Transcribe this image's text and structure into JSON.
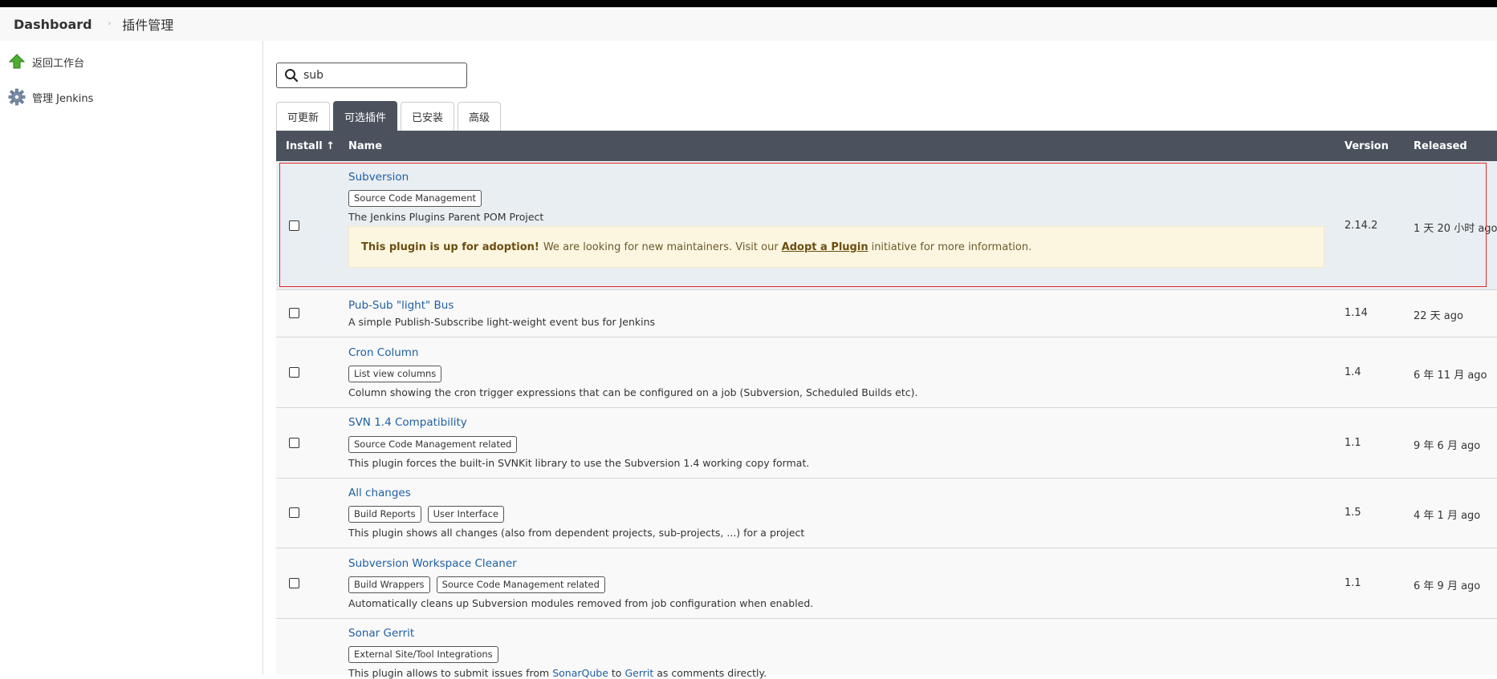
{
  "breadcrumb": {
    "dashboard": "Dashboard",
    "page": "插件管理",
    "separator": "›"
  },
  "sidebar": {
    "items": [
      {
        "label": "返回工作台",
        "icon": "arrow-up-icon"
      },
      {
        "label": "管理 Jenkins",
        "icon": "gear-icon"
      }
    ]
  },
  "search": {
    "value": "sub",
    "placeholder": ""
  },
  "tabs": [
    {
      "label": "可更新",
      "active": false
    },
    {
      "label": "可选插件",
      "active": true
    },
    {
      "label": "已安装",
      "active": false
    },
    {
      "label": "高级",
      "active": false
    }
  ],
  "table": {
    "headers": {
      "install": "Install ↑",
      "name": "Name",
      "version": "Version",
      "released": "Released"
    },
    "rows": [
      {
        "name": "Subversion",
        "tags": [
          "Source Code Management"
        ],
        "desc": "The Jenkins Plugins Parent POM Project",
        "adoption": {
          "bold": "This plugin is up for adoption!",
          "text1": "We are looking for new maintainers. Visit our",
          "link": "Adopt a Plugin",
          "text2": "initiative for more information."
        },
        "version": "2.14.2",
        "released": "1 天 20 小时 ago"
      },
      {
        "name": "Pub-Sub \"light\" Bus",
        "tags": [],
        "desc": "A simple Publish-Subscribe light-weight event bus for Jenkins",
        "version": "1.14",
        "released": "22 天 ago"
      },
      {
        "name": "Cron Column",
        "tags": [
          "List view columns"
        ],
        "desc": "Column showing the cron trigger expressions that can be configured on a job (Subversion, Scheduled Builds etc).",
        "version": "1.4",
        "released": "6 年 11 月 ago"
      },
      {
        "name": "SVN 1.4 Compatibility",
        "tags": [
          "Source Code Management related"
        ],
        "desc": "This plugin forces the built-in SVNKit library to use the Subversion 1.4 working copy format.",
        "version": "1.1",
        "released": "9 年 6 月 ago"
      },
      {
        "name": "All changes",
        "tags": [
          "Build Reports",
          "User Interface"
        ],
        "desc": "This plugin shows all changes (also from dependent projects, sub-projects, ...) for a project",
        "version": "1.5",
        "released": "4 年 1 月 ago"
      },
      {
        "name": "Subversion Workspace Cleaner",
        "tags": [
          "Build Wrappers",
          "Source Code Management related"
        ],
        "desc": "Automatically cleans up Subversion modules removed from job configuration when enabled.",
        "version": "1.1",
        "released": "6 年 9 月 ago"
      },
      {
        "name": "Sonar Gerrit",
        "tags": [
          "External Site/Tool Integrations"
        ],
        "desc_parts": {
          "t1": "This plugin allows to submit issues from",
          "l1": "SonarQube",
          "t2": "to",
          "l2": "Gerrit",
          "t3": "as comments directly."
        },
        "version": "",
        "released": ""
      }
    ]
  },
  "colors": {
    "header_bg": "#4b525d",
    "link": "#1f5fa3",
    "highlight_border": "#e3262b",
    "adoption_bg": "#fcf6e0"
  }
}
